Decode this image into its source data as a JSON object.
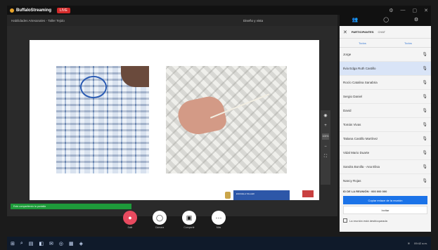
{
  "app": {
    "name": "BuffaloStreaming",
    "live_badge": "LIVE",
    "win_ctrls": [
      "⚙",
      "—",
      "▢",
      "✕"
    ]
  },
  "meeting": {
    "title": "Habilidades Artesanales - Taller Tejido",
    "layout_label": "Diseño y vista"
  },
  "slide": {
    "footer_tag": "ESCUELA TALLER"
  },
  "side_tools": [
    "◉",
    "+",
    "100%",
    "−",
    "⛶"
  ],
  "zoom_label": "100%",
  "share_bar": {
    "text": "Está compartiendo la pantalla"
  },
  "controls": [
    {
      "icon": "●",
      "label": "Salir",
      "red": true
    },
    {
      "icon": "◯",
      "label": "Cámara",
      "red": false
    },
    {
      "icon": "▣",
      "label": "Compartir",
      "red": false
    },
    {
      "icon": "⋯",
      "label": "Más",
      "red": false
    }
  ],
  "panel": {
    "tab_participants": "PARTICIPANTES",
    "tab_chat": "CHAT",
    "subtab_all": "Todos",
    "subtab_mute": "Todos",
    "people": [
      {
        "name": "Jorge",
        "sel": false
      },
      {
        "name": "Ilvia Edga Ruth Castillo",
        "sel": true
      },
      {
        "name": "Rocío Catalina Sanabria",
        "sel": false
      },
      {
        "name": "Sergio Daniel",
        "sel": false
      },
      {
        "name": "David",
        "sel": false
      },
      {
        "name": "Tomás Vivas",
        "sel": false
      },
      {
        "name": "Tatiana Castillo Martínez",
        "sel": false
      },
      {
        "name": "Vidal Mario Duarte",
        "sel": false
      },
      {
        "name": "Sandra Bonilla - Ana Elisa",
        "sel": false
      },
      {
        "name": "Nancy Rojas",
        "sel": false
      }
    ],
    "room_label": "ID DE LA REUNIÓN · 000 000 000",
    "room_btn": "Copiar enlace de la reunión",
    "room_btn2": "Invitar",
    "room_check": "La reunión está desbloqueada"
  },
  "taskbar": {
    "icons": [
      "⊞",
      "⌕",
      "▤",
      "◧",
      "✉",
      "◎",
      "▦",
      "◈"
    ],
    "tray_time": "09:42 a.m."
  }
}
